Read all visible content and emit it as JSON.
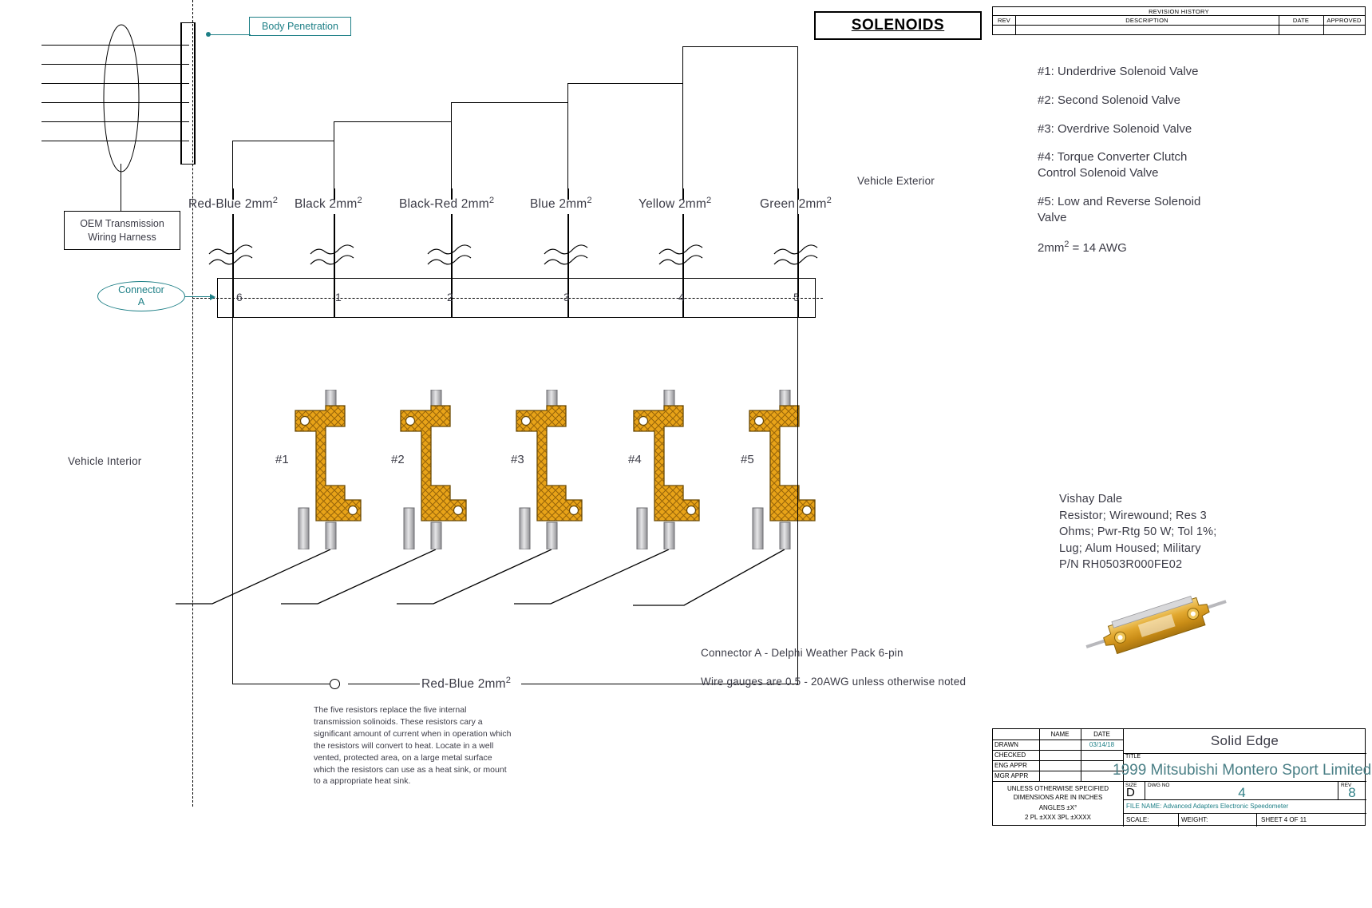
{
  "banner": {
    "title": "SOLENOIDS"
  },
  "callouts": {
    "body_penetration": "Body Penetration",
    "connector_a_line1": "Connector",
    "connector_a_line2": "A"
  },
  "labels": {
    "vehicle_exterior": "Vehicle Exterior",
    "vehicle_interior": "Vehicle Interior",
    "oem_harness_line1": "OEM Transmission",
    "oem_harness_line2": "Wiring Harness",
    "bottom_wire": "Red-Blue 2mm",
    "bottom_wire_sup": "2"
  },
  "wires": [
    {
      "name": "Red-Blue 2mm",
      "sup": "2",
      "pin": "6",
      "resistor": "#1"
    },
    {
      "name": "Black 2mm",
      "sup": "2",
      "pin": "1",
      "resistor": "#2"
    },
    {
      "name": "Black-Red 2mm",
      "sup": "2",
      "pin": "2",
      "resistor": "#3"
    },
    {
      "name": "Blue 2mm",
      "sup": "2",
      "pin": "3",
      "resistor": "#4"
    },
    {
      "name": "Yellow 2mm",
      "sup": "2",
      "pin": "4",
      "resistor": "#5"
    },
    {
      "name": "Green 2mm",
      "sup": "2",
      "pin": "5",
      "resistor": ""
    }
  ],
  "legend": {
    "items": [
      "#1: Underdrive Solenoid Valve",
      "#2: Second Solenoid Valve",
      "#3: Overdrive Solenoid Valve",
      "#4: Torque Converter Clutch Control Solenoid Valve",
      "#5: Low and Reverse Solenoid Valve"
    ],
    "gauge_note_pre": "2mm",
    "gauge_note_sup": "2",
    "gauge_note_post": " = 14 AWG"
  },
  "part": {
    "lines": [
      "Vishay Dale",
      "Resistor; Wirewound; Res 3",
      "Ohms; Pwr-Rtg 50 W; Tol 1%;",
      "Lug; Alum Housed; Military",
      "P/N RH0503R000FE02"
    ]
  },
  "notes": {
    "connector_note": "Connector A - Delphi Weather Pack 6-pin",
    "gauge_note": "Wire gauges are 0.5 - 20AWG unless otherwise noted",
    "paragraph": "The five resistors replace the five internal transmission solinoids. These resistors cary a significant amount of current when in operation which the resistors will convert to heat. Locate in a well vented, protected area, on a large metal surface which the resistors can use as a heat sink, or mount to a appropriate heat sink."
  },
  "revision_history": {
    "title": "REVISION HISTORY",
    "columns": [
      "REV",
      "DESCRIPTION",
      "DATE",
      "APPROVED"
    ],
    "rows": []
  },
  "title_block": {
    "col_name": "NAME",
    "col_date": "DATE",
    "rows": [
      {
        "role": "DRAWN",
        "name": "",
        "date": "03/14/18"
      },
      {
        "role": "CHECKED",
        "name": "",
        "date": ""
      },
      {
        "role": "ENG APPR",
        "name": "",
        "date": ""
      },
      {
        "role": "MGR APPR",
        "name": "",
        "date": ""
      }
    ],
    "tolerance": [
      "UNLESS OTHERWISE SPECIFIED",
      "DIMENSIONS ARE IN INCHES",
      "ANGLES ±X°",
      "2 PL ±XXX  3PL ±XXXX"
    ],
    "software": "Solid Edge",
    "title_caption": "TITLE",
    "title": "1999 Mitsubishi Montero Sport Limited",
    "size_caption": "SIZE",
    "size": "D",
    "dwgno_caption": "DWG NO",
    "dwgno": "4",
    "rev_caption": "REV",
    "rev": "8",
    "filename": "FILE NAME: Advanced Adapters Electronic Speedometer",
    "scale_caption": "SCALE:",
    "weight_caption": "WEIGHT:",
    "sheet": "SHEET 4 OF 11"
  },
  "colors": {
    "teal": "#1d7f86",
    "resistor_body": "#e8a318",
    "resistor_hatch": "#8a5a06",
    "ink": "#3b3b46"
  }
}
